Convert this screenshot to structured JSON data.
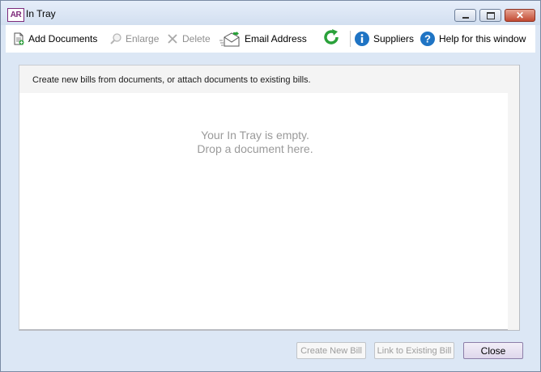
{
  "window": {
    "app_logo": "AR",
    "title": "In Tray",
    "controls": {
      "minimize": "minimize",
      "maximize": "maximize",
      "close": "close"
    }
  },
  "toolbar": {
    "add_documents": "Add Documents",
    "enlarge": "Enlarge",
    "delete": "Delete",
    "email_address": "Email Address",
    "suppliers": "Suppliers",
    "help": "Help for this window"
  },
  "panel": {
    "instruction": "Create new bills from documents, or attach documents to existing bills.",
    "empty_line1": "Your In Tray is empty.",
    "empty_line2": "Drop a document here."
  },
  "footer": {
    "create_new_bill": "Create New Bill",
    "link_to_existing_bill": "Link to Existing Bill",
    "close": "Close"
  },
  "colors": {
    "accent_green": "#2aa13a",
    "info_blue": "#1f74c4",
    "logo_purple": "#7d2a7a"
  }
}
